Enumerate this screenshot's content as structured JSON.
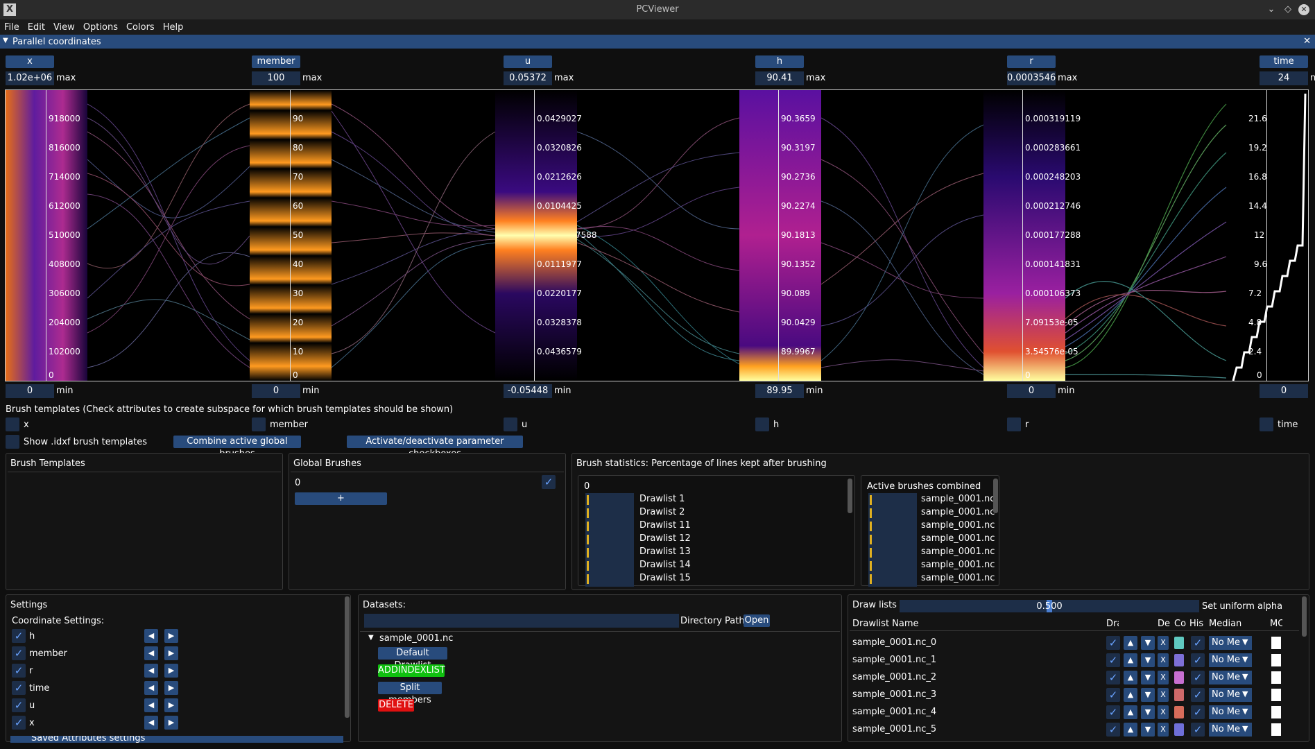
{
  "window": {
    "title": "PCViewer"
  },
  "menu": [
    "File",
    "Edit",
    "View",
    "Options",
    "Colors",
    "Help"
  ],
  "panel_title": "Parallel coordinates",
  "axes": [
    {
      "name": "x",
      "max": "1.02e+06",
      "min": "0",
      "ticks": [
        "918000",
        "816000",
        "714000",
        "612000",
        "510000",
        "408000",
        "306000",
        "204000",
        "102000",
        "0"
      ]
    },
    {
      "name": "member",
      "max": "100",
      "min": "0",
      "ticks": [
        "90",
        "80",
        "70",
        "60",
        "50",
        "40",
        "30",
        "20",
        "10",
        "0"
      ]
    },
    {
      "name": "u",
      "max": "0.05372",
      "min": "-0.05448",
      "ticks": [
        "0.0429027",
        "0.0320826",
        "0.0212626",
        "0.0104425",
        "7588",
        "0.0111977",
        "0.0220177",
        "0.0328378",
        "0.0436579"
      ]
    },
    {
      "name": "h",
      "max": "90.41",
      "min": "89.95",
      "ticks": [
        "90.3659",
        "90.3197",
        "90.2736",
        "90.2274",
        "90.1813",
        "90.1352",
        "90.089",
        "90.0429",
        "89.9967"
      ]
    },
    {
      "name": "r",
      "max": "0.0003546",
      "min": "0",
      "ticks": [
        "0.000319119",
        "0.000283661",
        "0.000248203",
        "0.000212746",
        "0.000177288",
        "0.000141831",
        "0.000106373",
        "7.09153e-05",
        "3.54576e-05",
        "0"
      ]
    },
    {
      "name": "time",
      "max": "24",
      "min": "0",
      "ticks": [
        "21.6",
        "19.2",
        "16.8",
        "14.4",
        "12",
        "9.6",
        "7.2",
        "4.8",
        "2.4",
        "0"
      ]
    }
  ],
  "labels": {
    "max": "max",
    "min": "min",
    "max_cut": "n"
  },
  "brush_templates": {
    "heading": "Brush templates (Check attributes to create subspace for which brush templates should be shown)",
    "attrs": [
      "x",
      "member",
      "u",
      "h",
      "r",
      "time"
    ],
    "show_idxf": "Show .idxf brush templates",
    "combine_btn": "Combine active global brushes",
    "activate_btn": "Activate/deactivate parameter checkboxes"
  },
  "brush_templates_panel": {
    "title": "Brush Templates"
  },
  "global_brushes": {
    "title": "Global Brushes",
    "item": "0",
    "add": "+"
  },
  "brush_stats": {
    "title": "Brush statistics: Percentage of lines kept after brushing",
    "left_header": "0",
    "left_items": [
      "Drawlist 1",
      "Drawlist 2",
      "Drawlist 11",
      "Drawlist 12",
      "Drawlist 13",
      "Drawlist 14",
      "Drawlist 15"
    ],
    "right_header": "Active brushes combined",
    "right_items": [
      "sample_0001.nc",
      "sample_0001.nc",
      "sample_0001.nc",
      "sample_0001.nc",
      "sample_0001.nc",
      "sample_0001.nc",
      "sample_0001.nc"
    ]
  },
  "settings": {
    "title": "Settings",
    "subtitle": "Coordinate Settings:",
    "items": [
      "h",
      "member",
      "r",
      "time",
      "u",
      "x"
    ],
    "saved": "Saved Attributes settings"
  },
  "datasets": {
    "title": "Datasets:",
    "dir_label": "Directory Path",
    "open": "Open",
    "dataset_name": "sample_0001.nc",
    "default_drawlist": "Default Drawlist",
    "addindexlist": "ADDINDEXLIST",
    "split": "Split members",
    "delete": "DELETE"
  },
  "drawlists": {
    "title": "Draw lists",
    "alpha_value": "0.500",
    "alpha_fraction": 0.5,
    "alpha_label": "Set uniform alpha",
    "columns": [
      "Drawlist Name",
      "Dra",
      "",
      "",
      "De",
      "Co",
      "His",
      "Median",
      "MC"
    ],
    "rows": [
      {
        "name": "sample_0001.nc_0",
        "color": "#5fc9c0",
        "median": "No Me"
      },
      {
        "name": "sample_0001.nc_1",
        "color": "#7d6fd6",
        "median": "No Me"
      },
      {
        "name": "sample_0001.nc_2",
        "color": "#c86fd0",
        "median": "No Me"
      },
      {
        "name": "sample_0001.nc_3",
        "color": "#d06a6a",
        "median": "No Me"
      },
      {
        "name": "sample_0001.nc_4",
        "color": "#d86c5a",
        "median": "No Me"
      },
      {
        "name": "sample_0001.nc_5",
        "color": "#6f6fd8",
        "median": "No Me"
      }
    ],
    "x_label": "X"
  }
}
